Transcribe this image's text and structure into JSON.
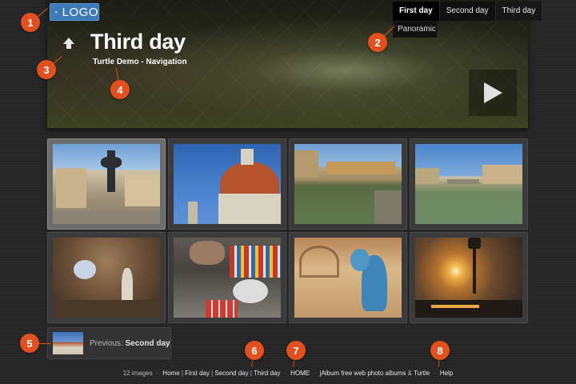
{
  "header": {
    "logo_text": "LOGO",
    "title": "Third day",
    "subtitle": "Turtle Demo - Navigation"
  },
  "nav": {
    "items": [
      {
        "label": "First day",
        "state": "active"
      },
      {
        "label": "Second day",
        "state": "normal"
      },
      {
        "label": "Third day",
        "state": "current"
      }
    ],
    "dropdown_label": "Panoramic"
  },
  "thumbnails": [
    {
      "subject": "Piazza della Signoria equestrian statue"
    },
    {
      "subject": "Florence cathedral dome"
    },
    {
      "subject": "Ponte Vecchio"
    },
    {
      "subject": "Arno river bridge"
    },
    {
      "subject": "Grotto statue"
    },
    {
      "subject": "Restorer working with paint jars"
    },
    {
      "subject": "Blue angel statue"
    },
    {
      "subject": "Sunset street lamp by river"
    }
  ],
  "previous": {
    "prefix": "Previous:",
    "label": "Second day"
  },
  "footer": {
    "count": "12 images",
    "breadcrumb_home": "Home",
    "breadcrumb_first": "First day",
    "breadcrumb_second": "Second day",
    "breadcrumb_third": "Third day",
    "home_link": "HOME",
    "credit_text": "jAlbum free web photo albums",
    "credit_amp": "&",
    "credit_theme": "Turtle",
    "help": "Help"
  },
  "callouts": [
    "1",
    "2",
    "3",
    "4",
    "5",
    "6",
    "7",
    "8"
  ],
  "colors": {
    "callout": "#e2501f",
    "logo_bg": "#3c7ab8",
    "page_bg": "#262626"
  },
  "icons": [
    "home-icon",
    "up-arrow-icon",
    "play-icon"
  ]
}
